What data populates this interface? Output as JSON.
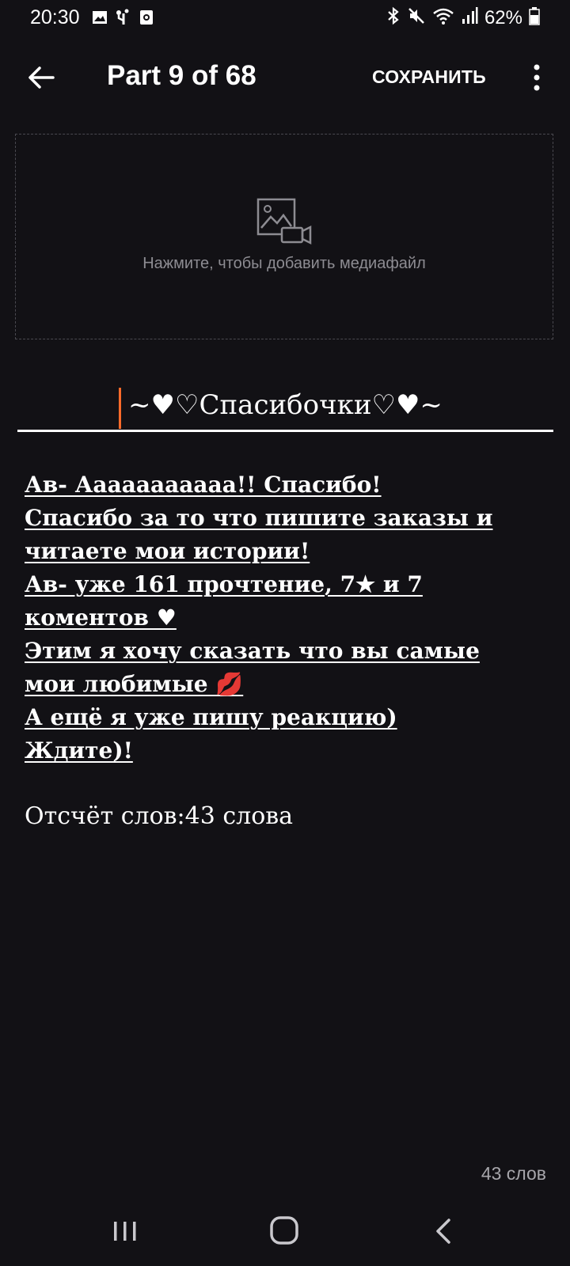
{
  "status_bar": {
    "time": "20:30",
    "battery": "62%",
    "left_icons": [
      "image-icon",
      "usb-icon",
      "vpn-icon"
    ],
    "right_icons": [
      "bluetooth-icon",
      "mute-icon",
      "wifi-icon",
      "signal-icon",
      "battery-icon"
    ]
  },
  "app_bar": {
    "title": "Part 9 of 68",
    "save_label": "СОХРАНИТЬ",
    "back_icon": "arrow-left-icon",
    "more_icon": "more-vert-icon"
  },
  "media": {
    "hint": "Нажмите, чтобы добавить медиафайл",
    "icon": "add-media-icon"
  },
  "chapter": {
    "title": "~♥♡Спасибочки♡♥~"
  },
  "story": {
    "lines": [
      "Ав- Ааааааааааа!! Спасибо!",
      "Спасибо за то что пишите заказы и",
      "читаете мои истории!",
      "Ав- уже 161 прочтение, 7★ и 7",
      "коментов ♥",
      "Этим я хочу сказать что вы самые",
      "мои любимые 💋",
      "А ещё я уже пишу реакцию)",
      "Ждите)! "
    ],
    "word_count_text": "Отсчёт слов:43 слова"
  },
  "footer": {
    "words_badge": "43 слов"
  },
  "nav_bar": {
    "items": [
      "recents-icon",
      "home-icon",
      "back-icon"
    ]
  },
  "colors": {
    "background": "#121115",
    "cursor": "#ff6a2a",
    "hint": "#8d8c92"
  }
}
